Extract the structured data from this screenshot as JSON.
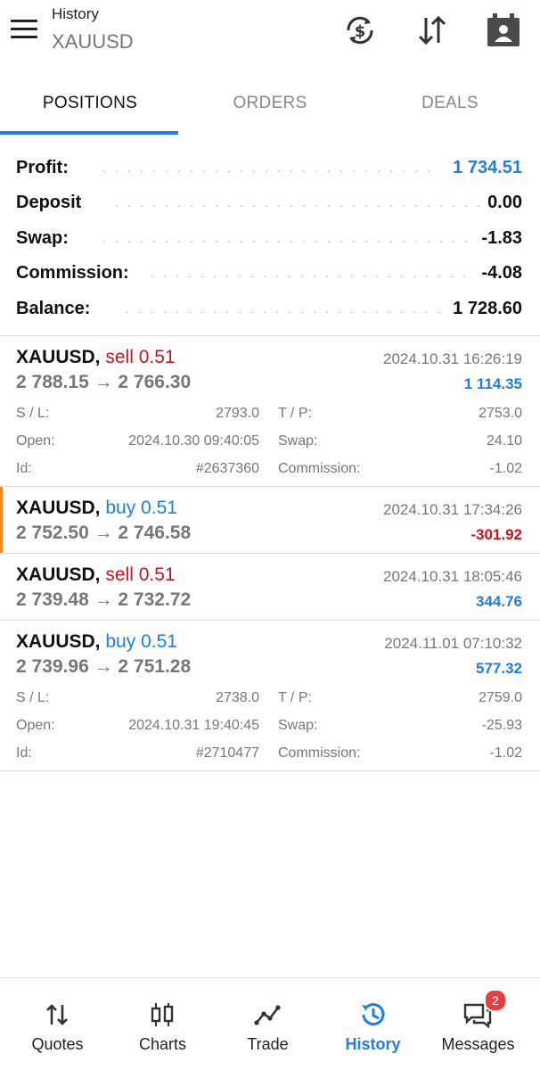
{
  "header": {
    "subtitle": "History",
    "title": "XAUUSD",
    "icons": [
      "menu-icon",
      "currency-refresh-icon",
      "sort-icon",
      "account-icon"
    ]
  },
  "tabs": [
    {
      "label": "POSITIONS",
      "active": true
    },
    {
      "label": "ORDERS",
      "active": false
    },
    {
      "label": "DEALS",
      "active": false
    }
  ],
  "summary": {
    "profit": {
      "label": "Profit:",
      "value": "1 734.51"
    },
    "deposit": {
      "label": "Deposit",
      "value": "0.00"
    },
    "swap": {
      "label": "Swap:",
      "value": "-1.83"
    },
    "commission": {
      "label": "Commission:",
      "value": "-4.08"
    },
    "balance": {
      "label": "Balance:",
      "value": "1 728.60"
    }
  },
  "positions": [
    {
      "symbol": "XAUUSD,",
      "side": "sell 0.51",
      "prices": "2 788.15 → 2 766.30",
      "datetime": "2024.10.31 16:26:19",
      "profit": "1 114.35",
      "details": {
        "sl_label": "S / L:",
        "sl": "2793.0",
        "tp_label": "T / P:",
        "tp": "2753.0",
        "open_label": "Open:",
        "open": "2024.10.30 09:40:05",
        "swap_label": "Swap:",
        "swap": "24.10",
        "id_label": "Id:",
        "id": "#2637360",
        "commission_label": "Commission:",
        "commission": "-1.02"
      }
    },
    {
      "symbol": "XAUUSD,",
      "side": "buy 0.51",
      "prices": "2 752.50 → 2 746.58",
      "datetime": "2024.10.31 17:34:26",
      "profit": "-301.92"
    },
    {
      "symbol": "XAUUSD,",
      "side": "sell 0.51",
      "prices": "2 739.48 → 2 732.72",
      "datetime": "2024.10.31 18:05:46",
      "profit": "344.76"
    },
    {
      "symbol": "XAUUSD,",
      "side": "buy 0.51",
      "prices": "2 739.96 → 2 751.28",
      "datetime": "2024.11.01 07:10:32",
      "profit": "577.32",
      "details": {
        "sl_label": "S / L:",
        "sl": "2738.0",
        "tp_label": "T / P:",
        "tp": "2759.0",
        "open_label": "Open:",
        "open": "2024.10.31 19:40:45",
        "swap_label": "Swap:",
        "swap": "-25.93",
        "id_label": "Id:",
        "id": "#2710477",
        "commission_label": "Commission:",
        "commission": "-1.02"
      }
    }
  ],
  "bottom_nav": [
    {
      "label": "Quotes",
      "icon": "quotes-icon",
      "active": false
    },
    {
      "label": "Charts",
      "icon": "charts-icon",
      "active": false
    },
    {
      "label": "Trade",
      "icon": "trade-icon",
      "active": false
    },
    {
      "label": "History",
      "icon": "history-icon",
      "active": true
    },
    {
      "label": "Messages",
      "icon": "messages-icon",
      "active": false,
      "badge": "2"
    }
  ],
  "colors": {
    "accent": "#1f7ee0",
    "loss": "#c8141e",
    "selected_marker": "#f08a24"
  }
}
